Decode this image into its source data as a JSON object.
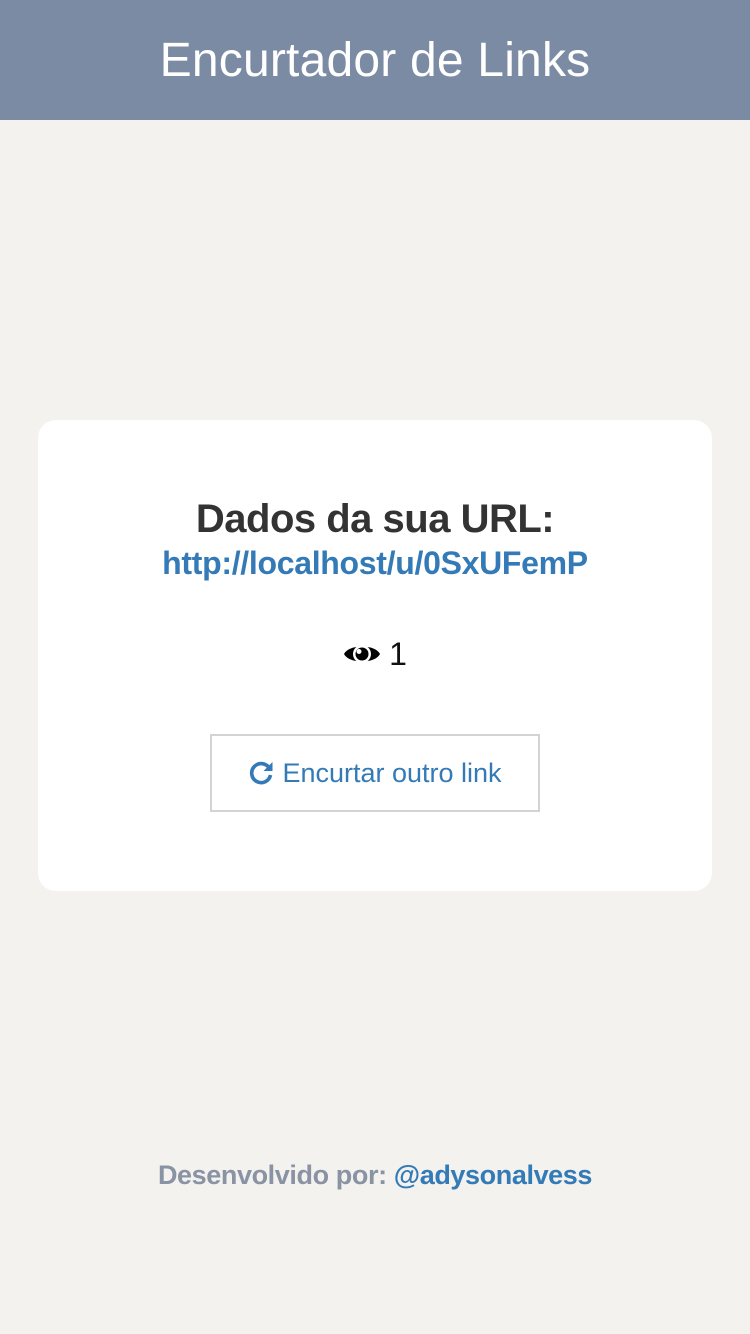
{
  "header": {
    "title": "Encurtador de Links"
  },
  "card": {
    "heading": "Dados da sua URL:",
    "short_url": "http://localhost/u/0SxUFemP",
    "views": {
      "icon": "eye-icon",
      "count": "1"
    },
    "reset_button": {
      "icon": "refresh-icon",
      "label": "Encurtar outro link"
    }
  },
  "footer": {
    "label": "Desenvolvido por:",
    "author": "@adysonalvess"
  },
  "colors": {
    "header_bg": "#7b8ba4",
    "page_bg": "#f3f2ee",
    "link": "#337ab7",
    "card_bg": "#ffffff"
  }
}
